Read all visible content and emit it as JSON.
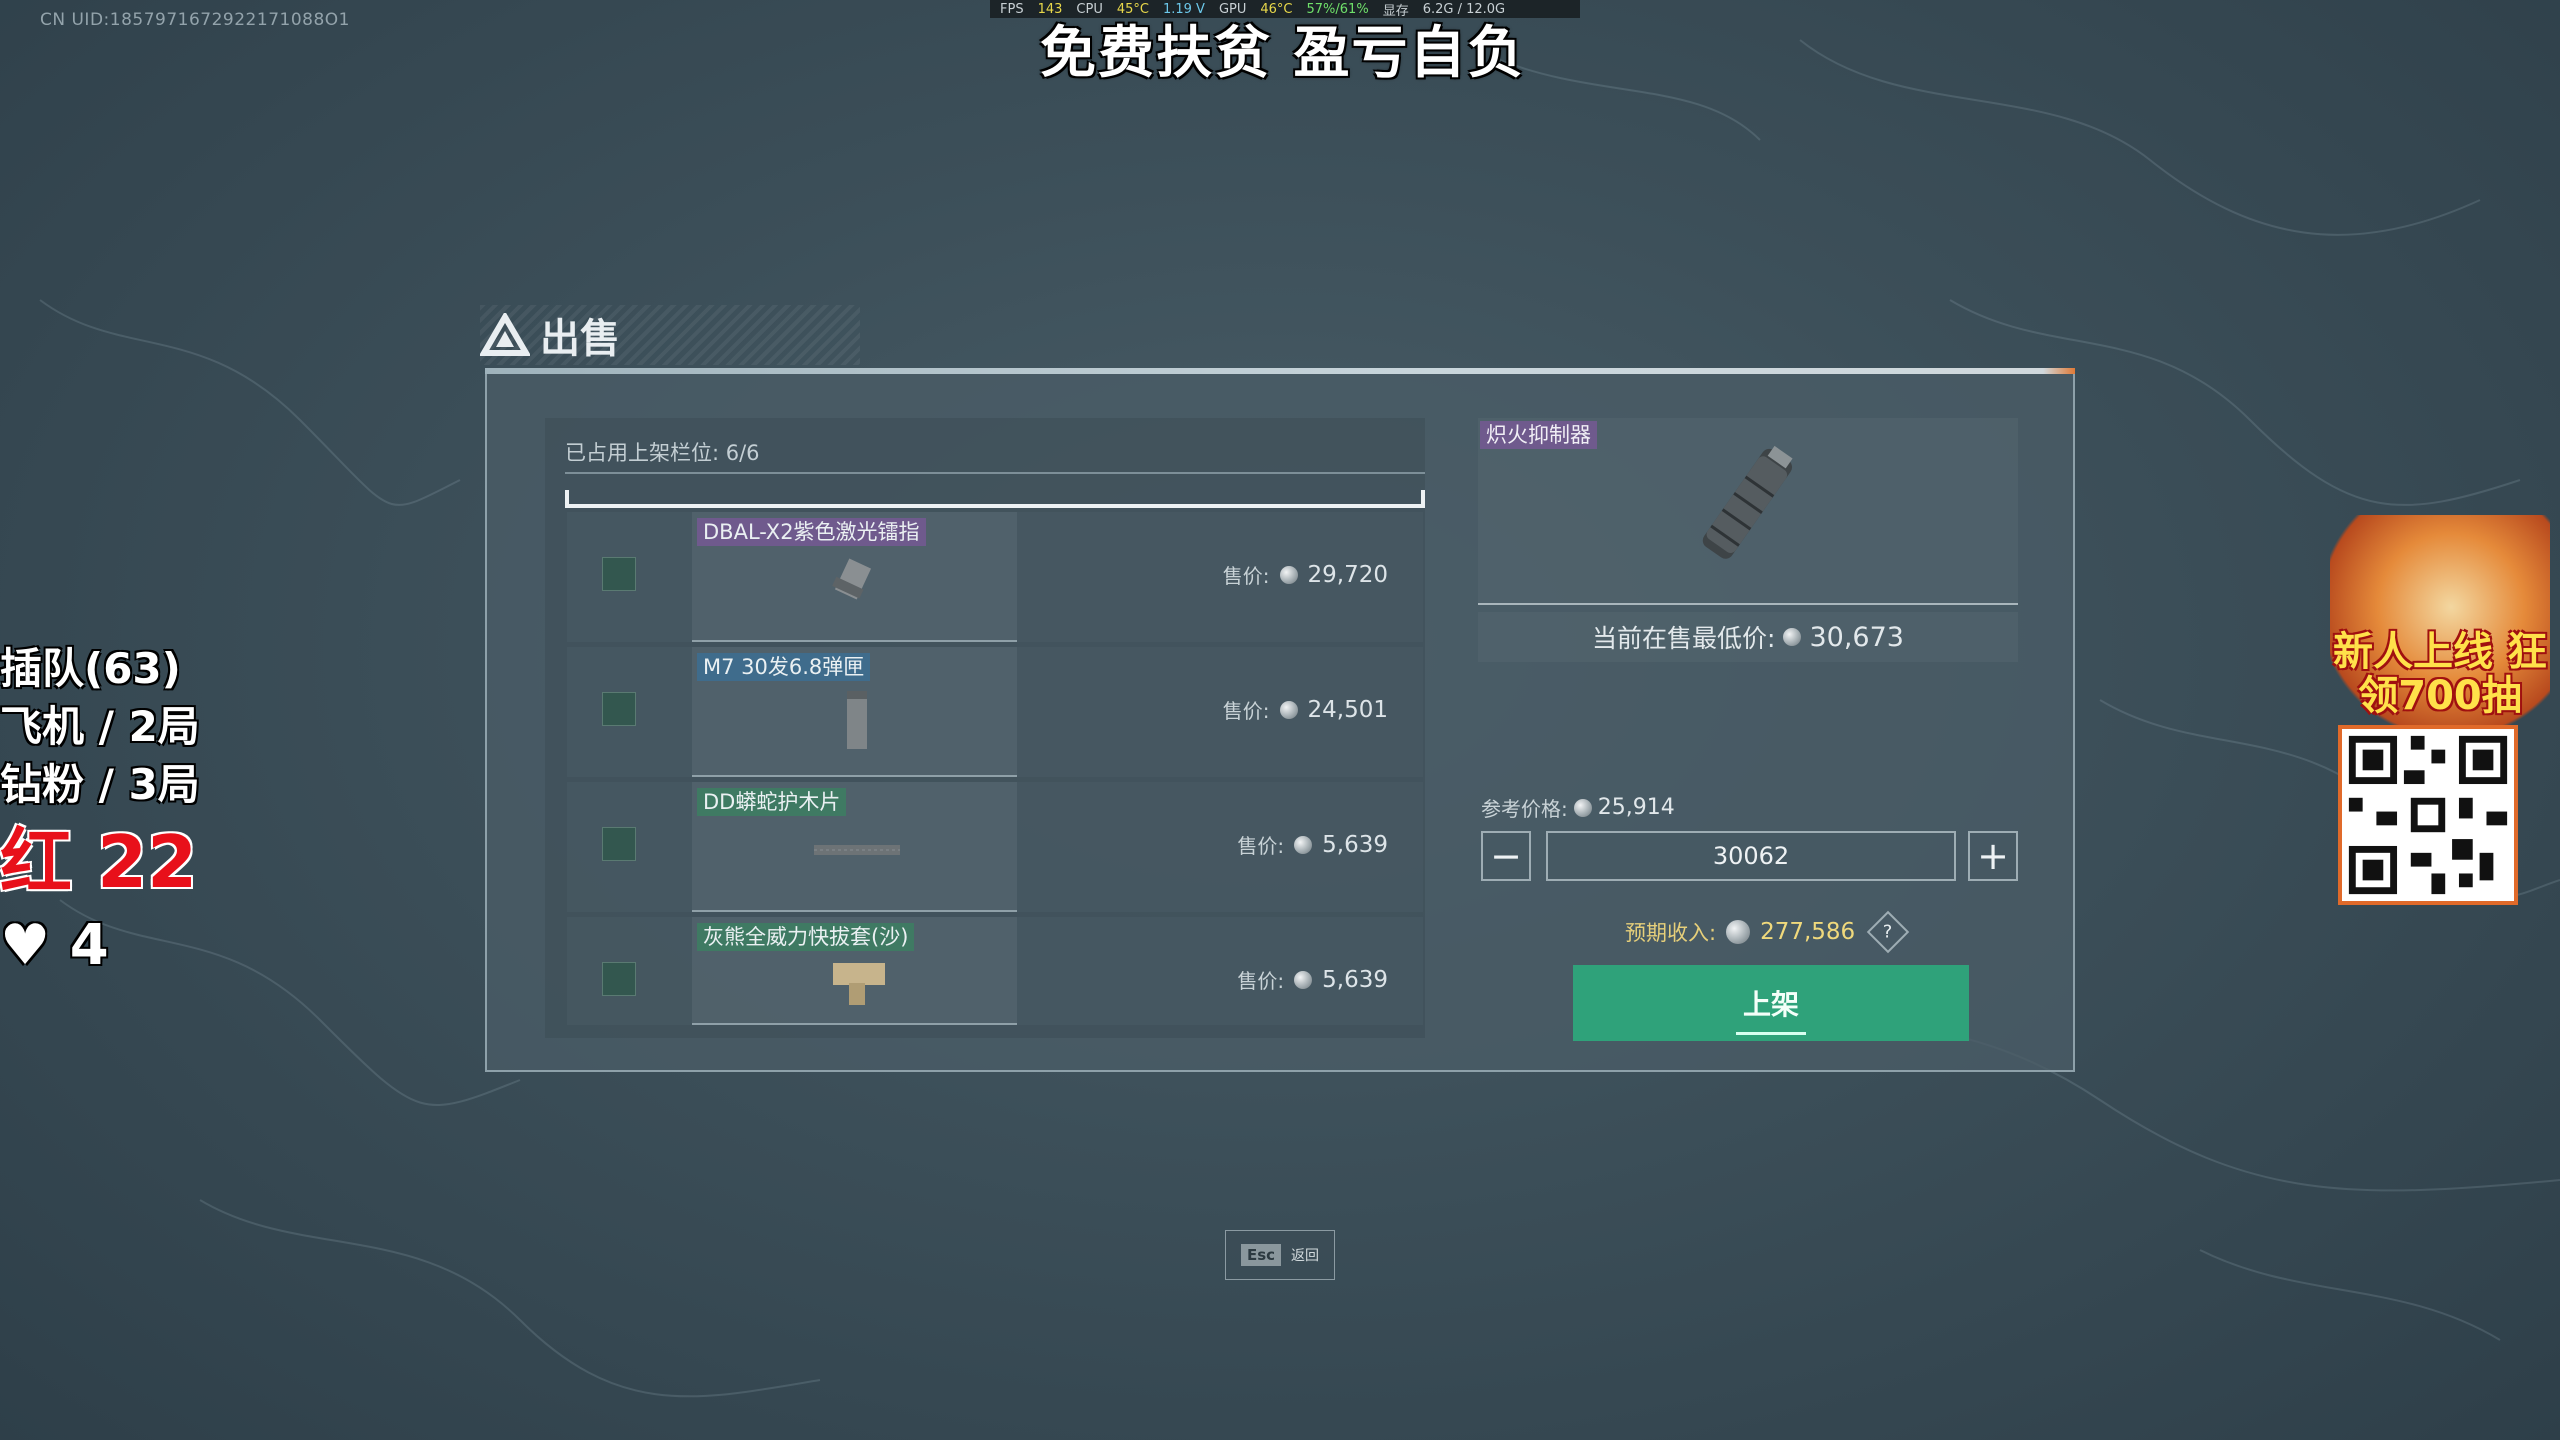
{
  "overlay": {
    "uid": "CN UID:1857971672922171088O1",
    "stream_title": "免费扶贫 盈亏自负",
    "perf": {
      "fps_label": "FPS",
      "fps": "143",
      "cpu_label": "CPU",
      "cpu_temp": "45°C",
      "voltage": "1.19 V",
      "gpu_label": "GPU",
      "gpu_temp": "46°C",
      "gpu_usage": "57%/61%",
      "mem_label": "显存",
      "mem": "6.2G / 12.0G"
    },
    "queue": "插队(63)",
    "plane": "飞机 / 2局",
    "diamond": "钻粉 / 3局",
    "red": "红 22",
    "hearts": "4",
    "promo_text": "新人上线 狂领700抽"
  },
  "dialog": {
    "title": "出售",
    "slots_label": "已占用上架栏位: 6/6",
    "items": [
      {
        "name": "DBAL-X2紫色激光镭指",
        "price_label": "售价:",
        "price": "29,720"
      },
      {
        "name": "M7 30发6.8弹匣",
        "price_label": "售价:",
        "price": "24,501"
      },
      {
        "name": "DD蟒蛇护木片",
        "price_label": "售价:",
        "price": "5,639"
      },
      {
        "name": "灰熊全威力快拔套(沙)",
        "price_label": "售价:",
        "price": "5,639"
      }
    ],
    "detail": {
      "item_name": "炽火抑制器",
      "lowest_label": "当前在售最低价:",
      "lowest_value": "30,673",
      "ref_label": "参考价格:",
      "ref_value": "25,914",
      "minus": "−",
      "plus": "+",
      "price_input": "30062",
      "income_label": "预期收入:",
      "income_value": "277,586",
      "help": "?",
      "list_button": "上架"
    },
    "esc_key": "Esc",
    "esc_label": "返回"
  },
  "colors": {
    "accent_green": "#2fa27a",
    "tag_purple": "#6f5a8d",
    "tag_blue": "#3f6c8c",
    "tag_green": "#3f7a63",
    "income_gold": "#e6cf7a"
  }
}
